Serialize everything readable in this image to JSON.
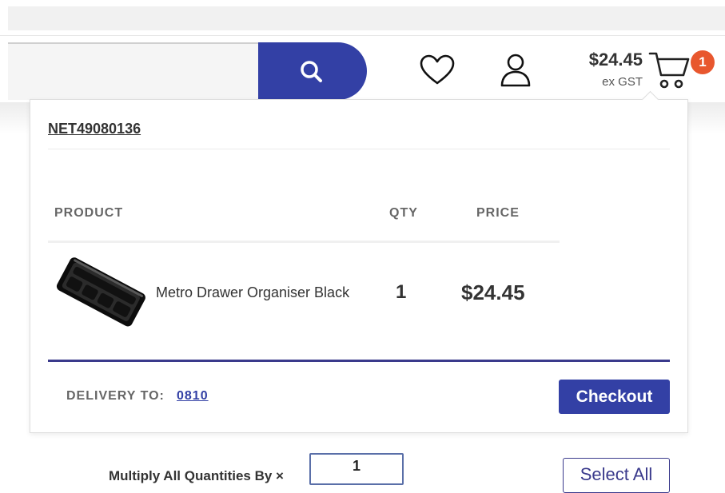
{
  "header": {
    "cart_total": "$24.45",
    "cart_tax_note": "ex GST",
    "cart_count": "1",
    "icons": [
      "search-icon",
      "heart-icon",
      "user-icon",
      "cart-icon"
    ]
  },
  "cart_dropdown": {
    "order_ref": "NET49080136",
    "columns": {
      "product": "PRODUCT",
      "qty": "QTY",
      "price": "PRICE"
    },
    "items": [
      {
        "name": "Metro Drawer Organiser Black",
        "qty": "1",
        "price": "$24.45"
      }
    ],
    "delivery_label": "DELIVERY TO:",
    "delivery_code": "0810",
    "checkout_label": "Checkout"
  },
  "bottom_bar": {
    "multiply_label": "Multiply All Quantities By ×",
    "multiply_value": "1",
    "select_all_label": "Select All"
  },
  "colors": {
    "brand_blue": "#3340a5",
    "badge_orange": "#e8572e",
    "accent_rule": "#3a3a8c"
  }
}
